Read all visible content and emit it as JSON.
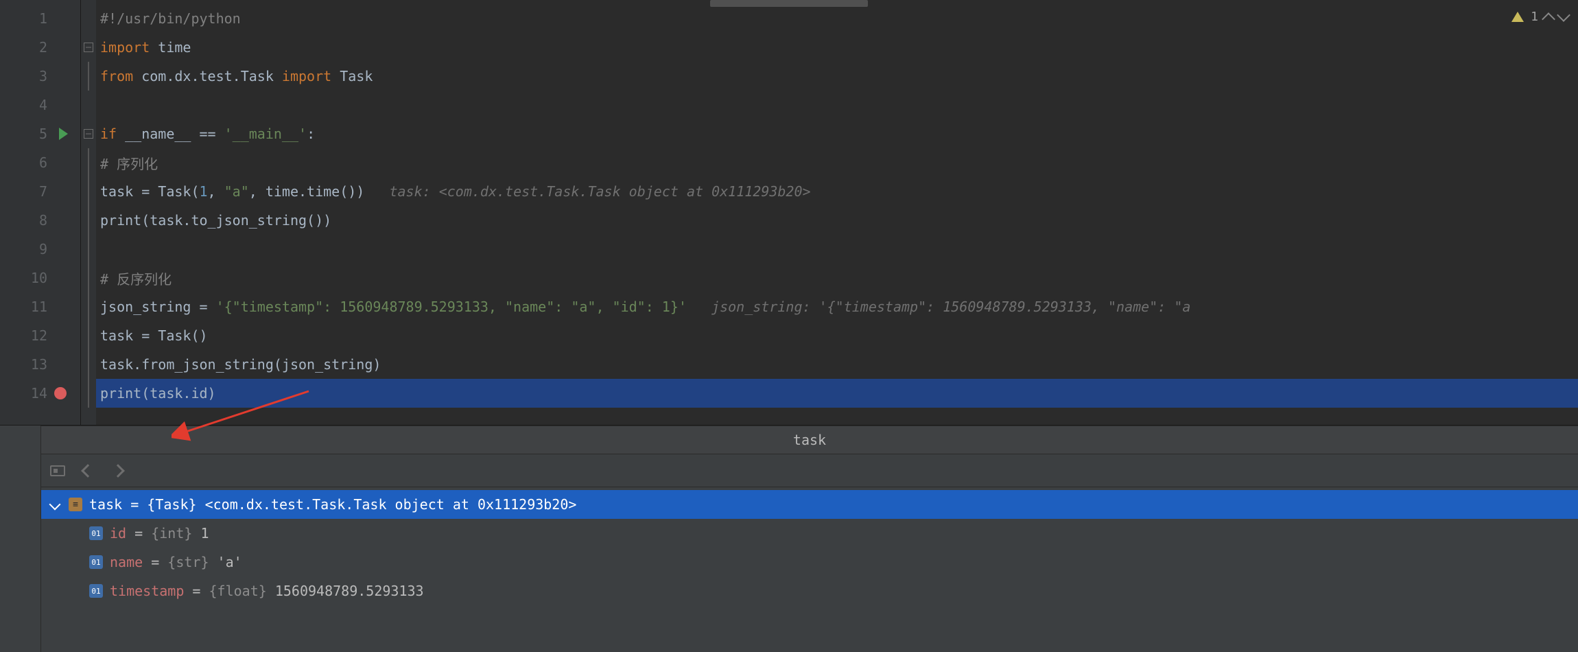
{
  "editor": {
    "lines": [
      {
        "n": 1
      },
      {
        "n": 2
      },
      {
        "n": 3
      },
      {
        "n": 4
      },
      {
        "n": 5,
        "run": true
      },
      {
        "n": 6
      },
      {
        "n": 7
      },
      {
        "n": 8
      },
      {
        "n": 9
      },
      {
        "n": 10
      },
      {
        "n": 11
      },
      {
        "n": 12
      },
      {
        "n": 13
      },
      {
        "n": 14,
        "breakpoint": true
      }
    ],
    "code": {
      "shebang": "#!/usr/bin/python",
      "import_kw": "import",
      "time_mod": " time",
      "from_kw": "from",
      "pkg": " com.dx.test.Task ",
      "import_kw2": "import",
      "task_cls": " Task",
      "if_kw": "if",
      "dunder": " __name__ == ",
      "main_str": "'__main__'",
      "colon": ":",
      "cmt1": "# 序列化",
      "l7_a": "task = Task(",
      "l7_n": "1",
      "l7_b": ", ",
      "l7_s": "\"a\"",
      "l7_c": ", time.time())",
      "l7_hint": "   task: <com.dx.test.Task.Task object at 0x111293b20>",
      "l8": "print(task.to_json_string())",
      "cmt2": "# 反序列化",
      "l11_a": "json_string = ",
      "l11_s": "'{\"timestamp\": 1560948789.5293133, \"name\": \"a\", \"id\": 1}'",
      "l11_hint": "   json_string: '{\"timestamp\": 1560948789.5293133, \"name\": \"a",
      "l12": "task = Task()",
      "l13": "task.from_json_string(json_string)",
      "l14_a": "print",
      "l14_b": "(task.id)"
    },
    "inspection": {
      "count": "1"
    }
  },
  "debug": {
    "header": "task",
    "root": {
      "label": "task = ",
      "type": "{Task}",
      "repr": " <com.dx.test.Task.Task object at 0x111293b20>"
    },
    "attrs": [
      {
        "name": "id",
        "eq": " = ",
        "type": "{int}",
        "val": " 1"
      },
      {
        "name": "name",
        "eq": " = ",
        "type": "{str}",
        "val": " 'a'"
      },
      {
        "name": "timestamp",
        "eq": " = ",
        "type": "{float}",
        "val": " 1560948789.5293133"
      }
    ]
  }
}
